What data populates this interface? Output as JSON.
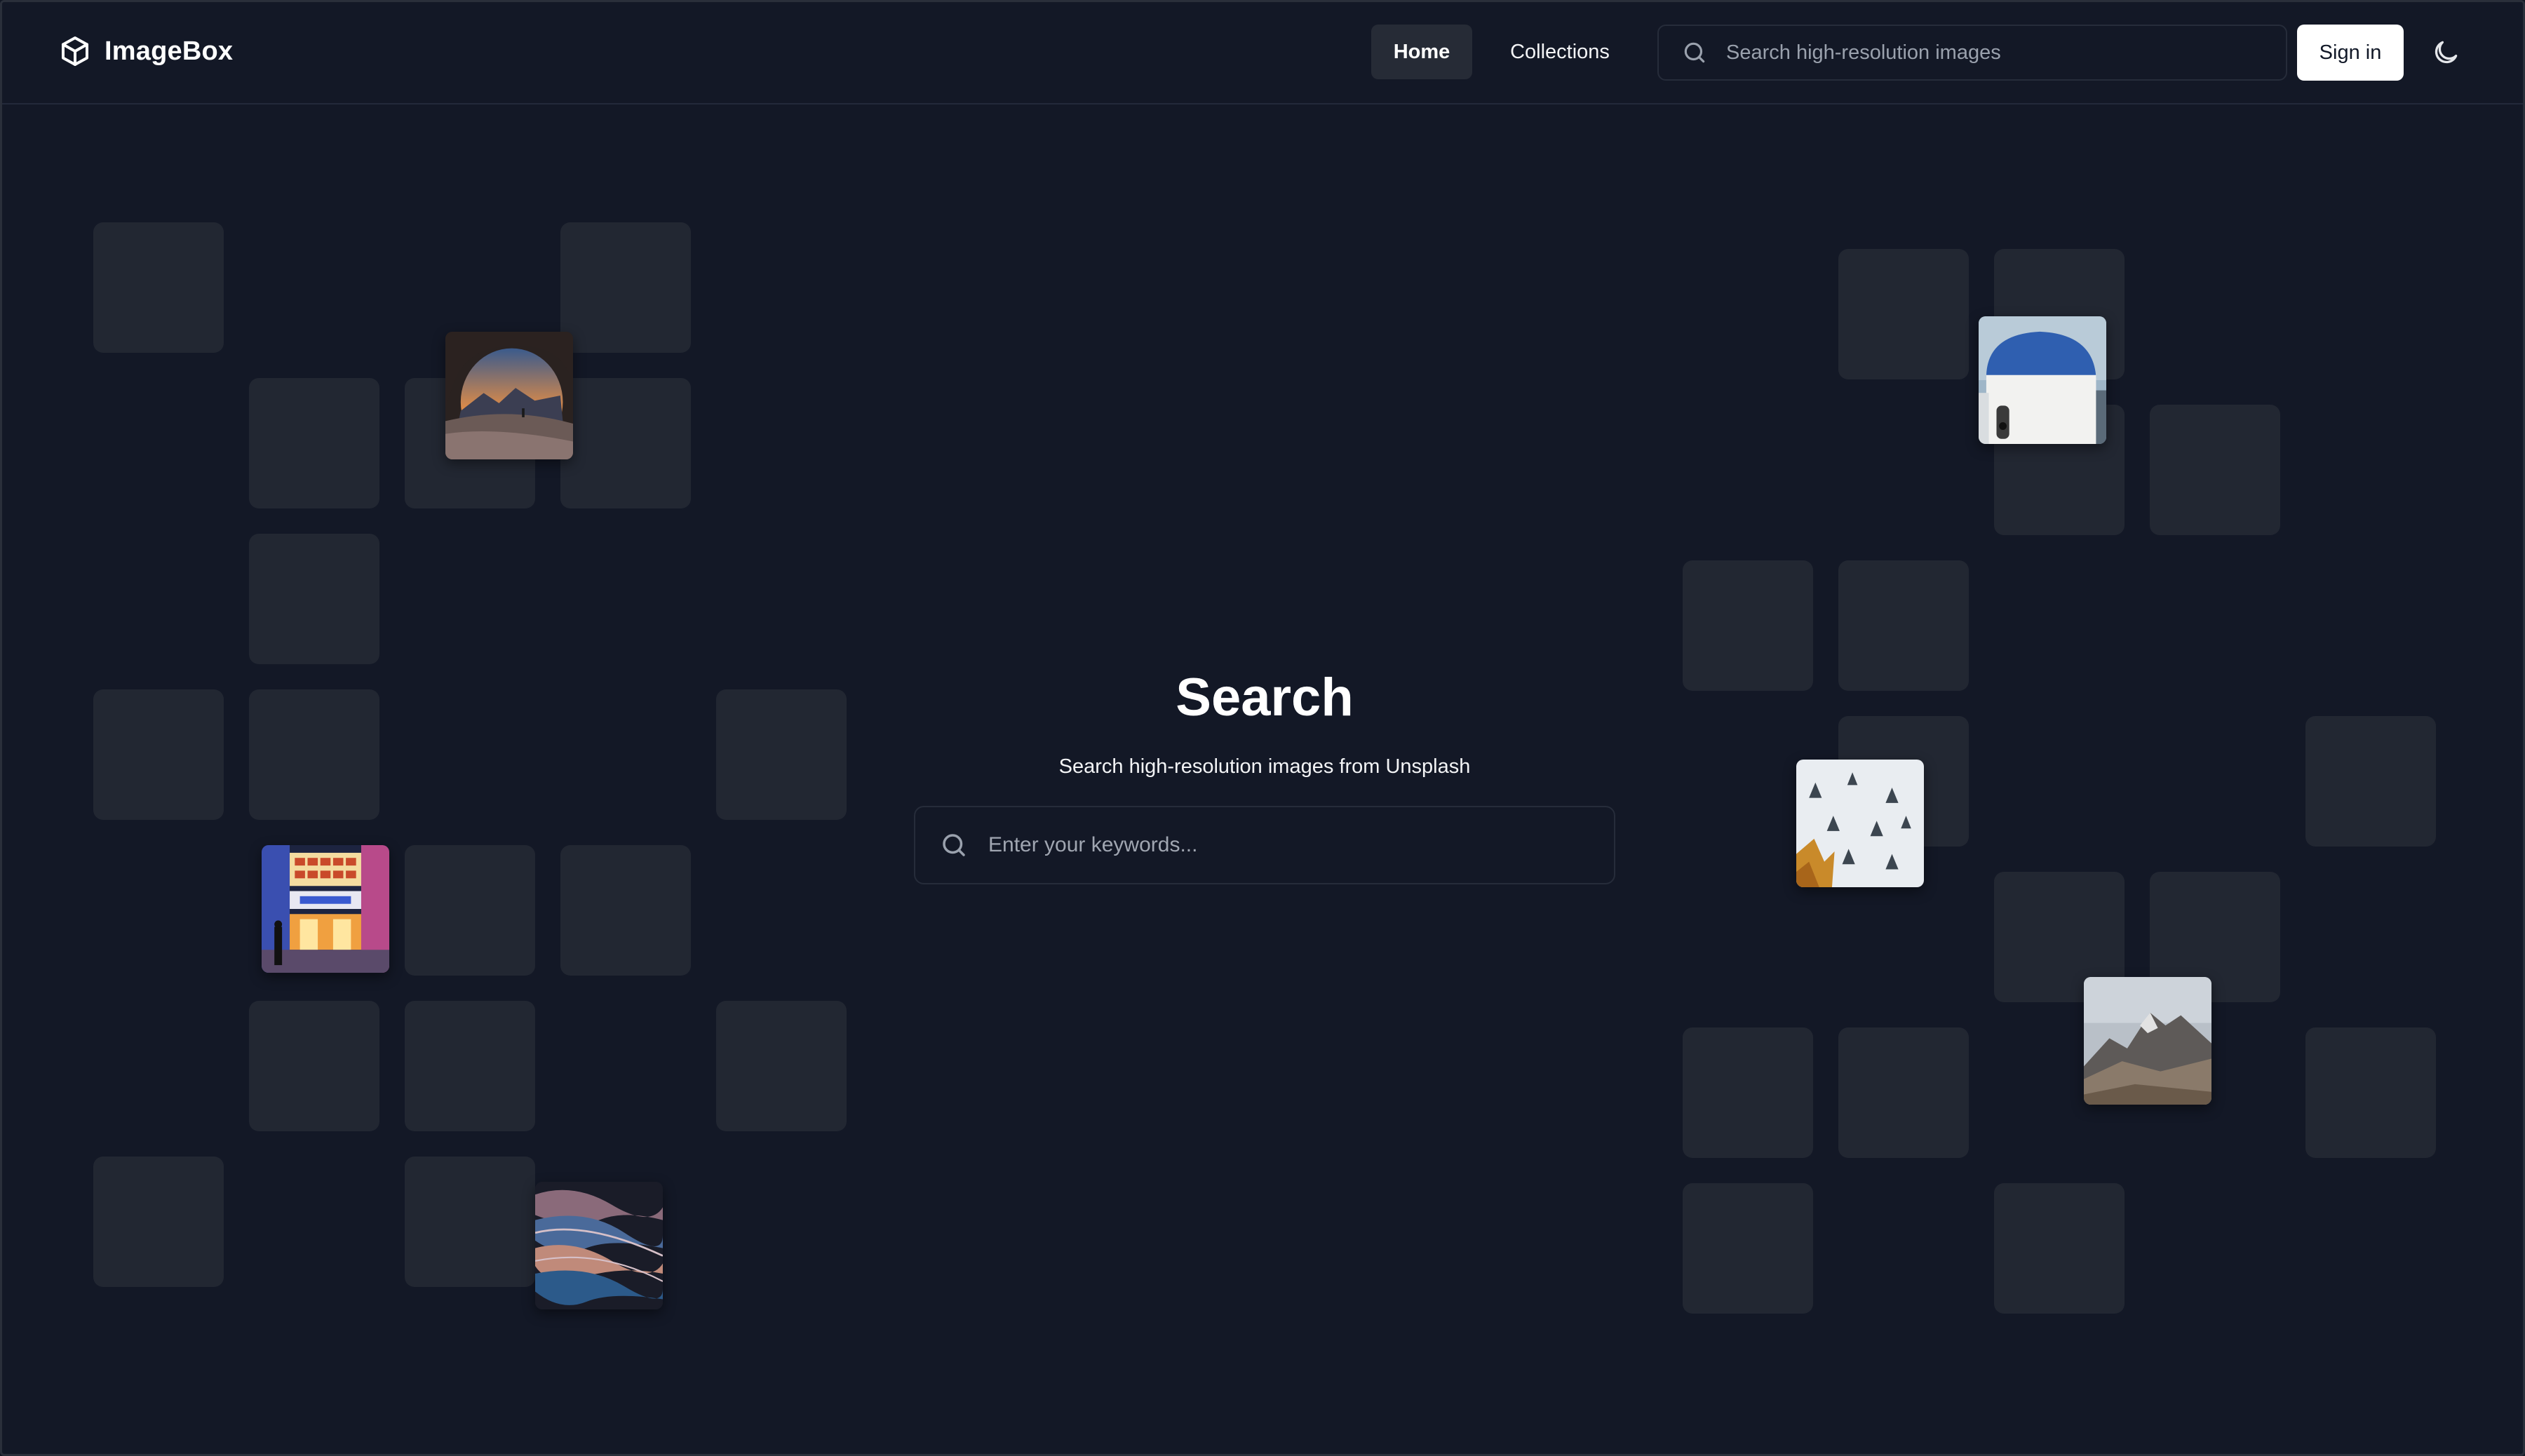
{
  "app": {
    "name": "ImageBox"
  },
  "nav": {
    "home_label": "Home",
    "collections_label": "Collections"
  },
  "header_search": {
    "placeholder": "Search high-resolution images"
  },
  "auth": {
    "signin_label": "Sign in"
  },
  "hero": {
    "title": "Search",
    "subtitle": "Search high-resolution images from Unsplash",
    "search_placeholder": "Enter your keywords..."
  },
  "photos": [
    {
      "subject": "cave-arch-sunset-landscape"
    },
    {
      "subject": "neon-storefront-night-street"
    },
    {
      "subject": "abstract-wavy-metallic-texture"
    },
    {
      "subject": "blue-dome-church"
    },
    {
      "subject": "snowy-forest-aerial"
    },
    {
      "subject": "rocky-mountain-peaks"
    }
  ],
  "icons": {
    "logo": "cube-icon",
    "search": "search-icon",
    "theme_toggle": "moon-icon"
  },
  "colors": {
    "background": "#131826",
    "tile": "#222732",
    "nav_active": "#262b36",
    "signin_bg": "#ffffff"
  }
}
